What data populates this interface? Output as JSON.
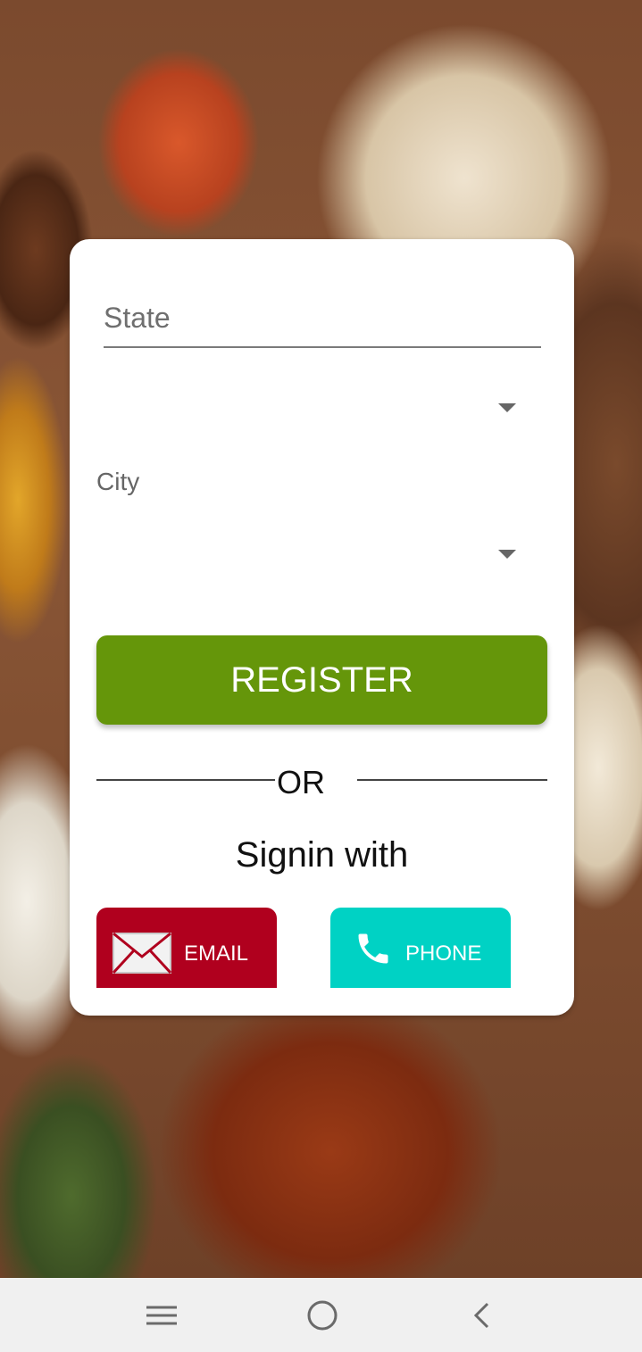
{
  "form": {
    "state_placeholder": "State",
    "state_value": "",
    "state_dropdown_value": "",
    "city_label": "City",
    "city_dropdown_value": ""
  },
  "actions": {
    "register_label": "REGISTER",
    "or_label": "OR",
    "signin_label": "Signin with",
    "email_label": "EMAIL",
    "phone_label": "PHONE"
  },
  "colors": {
    "register_green": "#65960a",
    "email_red": "#b0001e",
    "phone_teal": "#00d2c4"
  },
  "icons": {
    "email": "envelope-icon",
    "phone": "phone-icon",
    "nav_menu": "menu-icon",
    "nav_home": "home-circle-icon",
    "nav_back": "back-chevron-icon"
  }
}
